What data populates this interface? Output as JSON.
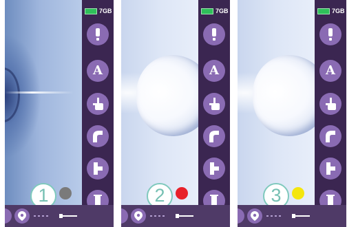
{
  "screens": [
    {
      "step_number": "1",
      "status_color": "#7a7a7a",
      "storage": "7GB",
      "tools": [
        "alert-icon",
        "text-A-icon",
        "pointing-hand-icon",
        "elbow-pipe-icon",
        "tee-pipe-icon",
        "straight-pipe-icon"
      ],
      "bottom_icons": [
        "location-pin-icon",
        "probe-icon"
      ]
    },
    {
      "step_number": "2",
      "status_color": "#e8212a",
      "storage": "7GB",
      "tools": [
        "alert-icon",
        "text-A-icon",
        "pointing-hand-icon",
        "elbow-pipe-icon",
        "tee-pipe-icon",
        "straight-pipe-icon"
      ],
      "bottom_icons": [
        "location-pin-icon",
        "probe-icon"
      ]
    },
    {
      "step_number": "3",
      "status_color": "#f4e60e",
      "storage": "7GB",
      "tools": [
        "alert-icon",
        "text-A-icon",
        "pointing-hand-icon",
        "elbow-pipe-icon",
        "tee-pipe-icon",
        "straight-pipe-icon"
      ],
      "bottom_icons": [
        "location-pin-icon",
        "probe-icon"
      ]
    }
  ],
  "colors": {
    "sidebar": "#3b2651",
    "tool_button": "#8a6bb3",
    "bottom_bar": "#4f3a67",
    "step_ring": "#7fc9bd",
    "battery": "#2fbf5a"
  },
  "letter_tool": "A"
}
